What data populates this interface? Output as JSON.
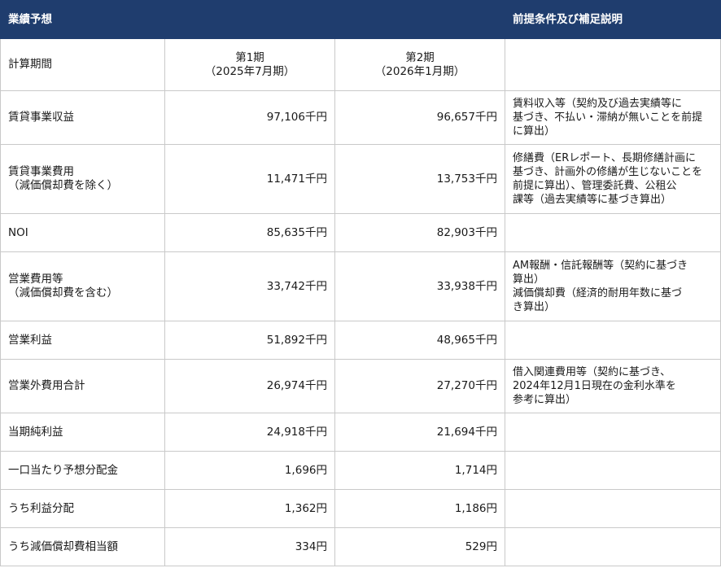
{
  "header": {
    "title": "業績予想",
    "notes_title": "前提条件及び補足説明"
  },
  "columns": {
    "label": "計算期間",
    "period1": {
      "name": "第1期",
      "range": "（2025年7月期）"
    },
    "period2": {
      "name": "第2期",
      "range": "（2026年1月期）"
    }
  },
  "rows": [
    {
      "label": "賃貸事業収益",
      "sublabel": "",
      "p1": "97,106千円",
      "p2": "96,657千円",
      "note": [
        "賃料収入等（契約及び過去実績等に",
        "基づき、不払い・滞納が無いことを前提",
        "に算出）"
      ]
    },
    {
      "label": "賃貸事業費用",
      "sublabel": "（減価償却費を除く）",
      "p1": "11,471千円",
      "p2": "13,753千円",
      "note": [
        "修繕費（ERレポート、長期修繕計画に",
        "基づき、計画外の修繕が生じないことを",
        "前提に算出）、管理委託費、公租公",
        "課等（過去実績等に基づき算出）"
      ]
    },
    {
      "label": "NOI",
      "sublabel": "",
      "p1": "85,635千円",
      "p2": "82,903千円",
      "note": []
    },
    {
      "label": "営業費用等",
      "sublabel": "（減価償却費を含む）",
      "p1": "33,742千円",
      "p2": "33,938千円",
      "note": [
        "AM報酬・信託報酬等（契約に基づき",
        "算出）",
        "減価償却費（経済的耐用年数に基づ",
        "き算出）"
      ]
    },
    {
      "label": "営業利益",
      "sublabel": "",
      "p1": "51,892千円",
      "p2": "48,965千円",
      "note": []
    },
    {
      "label": "営業外費用合計",
      "sublabel": "",
      "p1": "26,974千円",
      "p2": "27,270千円",
      "note": [
        "借入関連費用等（契約に基づき、",
        "2024年12月1日現在の金利水準を",
        "参考に算出）"
      ]
    },
    {
      "label": "当期純利益",
      "sublabel": "",
      "p1": "24,918千円",
      "p2": "21,694千円",
      "note": []
    },
    {
      "label": "一口当たり予想分配金",
      "sublabel": "",
      "p1": "1,696円",
      "p2": "1,714円",
      "note": []
    },
    {
      "label": "うち利益分配",
      "sublabel": "",
      "p1": "1,362円",
      "p2": "1,186円",
      "note": []
    },
    {
      "label": "うち減価償却費相当額",
      "sublabel": "",
      "p1": "334円",
      "p2": "529円",
      "note": []
    }
  ]
}
